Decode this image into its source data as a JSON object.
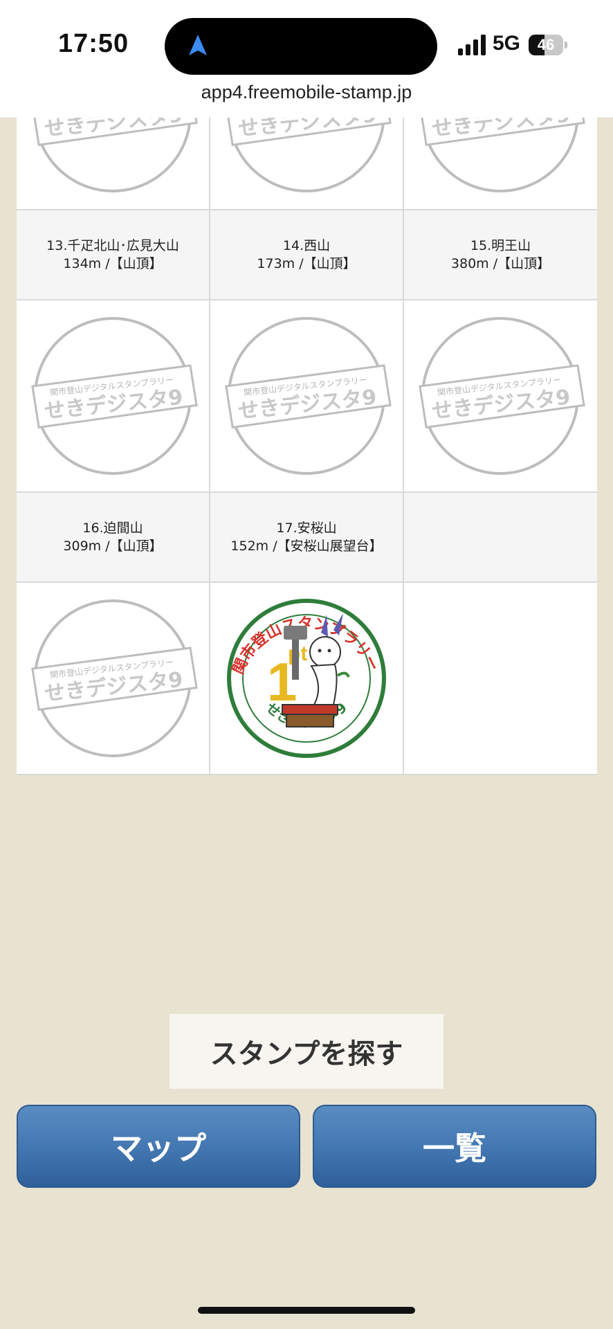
{
  "status_bar": {
    "time": "17:50",
    "network": "5G",
    "battery": "46",
    "battery_level_percent": 46,
    "nav_icon": "location-arrow-icon",
    "signal_icon": "cellular-signal-icon"
  },
  "browser": {
    "url": "app4.freemobile-stamp.jp"
  },
  "stamp_placeholder": {
    "top_text": "関市登山デジタルスタンプラリー",
    "main_text": "せきデジスタ9"
  },
  "collected_stamp": {
    "arc_text": "関市登山スタンプラリー",
    "points": "1",
    "points_unit": "pt",
    "bottom_text": "せきデジスタ9"
  },
  "stamps": [
    {
      "name_line": "13.千疋北山･広見大山",
      "detail_line": "134m /【山頂】"
    },
    {
      "name_line": "14.西山",
      "detail_line": "173m /【山頂】"
    },
    {
      "name_line": "15.明王山",
      "detail_line": "380m /【山頂】"
    },
    {
      "name_line": "16.迫間山",
      "detail_line": "309m /【山頂】"
    },
    {
      "name_line": "17.安桜山",
      "detail_line": "152m /【安桜山展望台】"
    }
  ],
  "buttons": {
    "search": "スタンプを探す",
    "map": "マップ",
    "list": "一覧"
  },
  "colors": {
    "background": "#e8e2d0",
    "button_blue": "#4276b0",
    "stamp_green": "#2e7d3a",
    "stamp_red": "#d9312b",
    "stamp_yellow": "#e8b820"
  }
}
